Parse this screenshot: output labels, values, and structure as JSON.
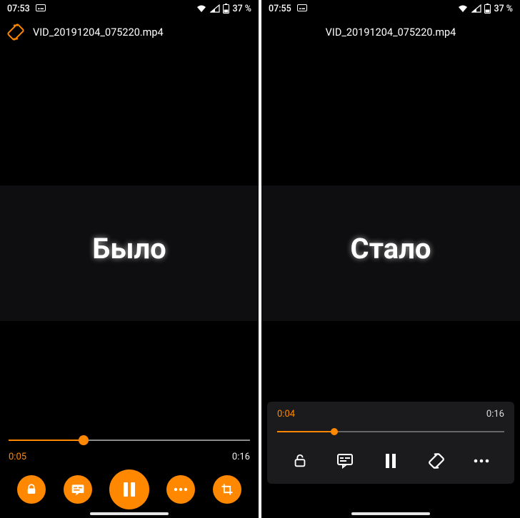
{
  "left": {
    "status": {
      "time": "07:53",
      "battery": "37 %"
    },
    "title": "VID_20191204_075220.mp4",
    "overlay": "Было",
    "player": {
      "current": "0:05",
      "duration": "0:16",
      "progress_pct": 31
    }
  },
  "right": {
    "status": {
      "time": "07:55",
      "battery": "37 %"
    },
    "title": "VID_20191204_075220.mp4",
    "overlay": "Стало",
    "player": {
      "current": "0:04",
      "duration": "0:16",
      "progress_pct": 25
    }
  },
  "colors": {
    "accent": "#ff8800"
  }
}
